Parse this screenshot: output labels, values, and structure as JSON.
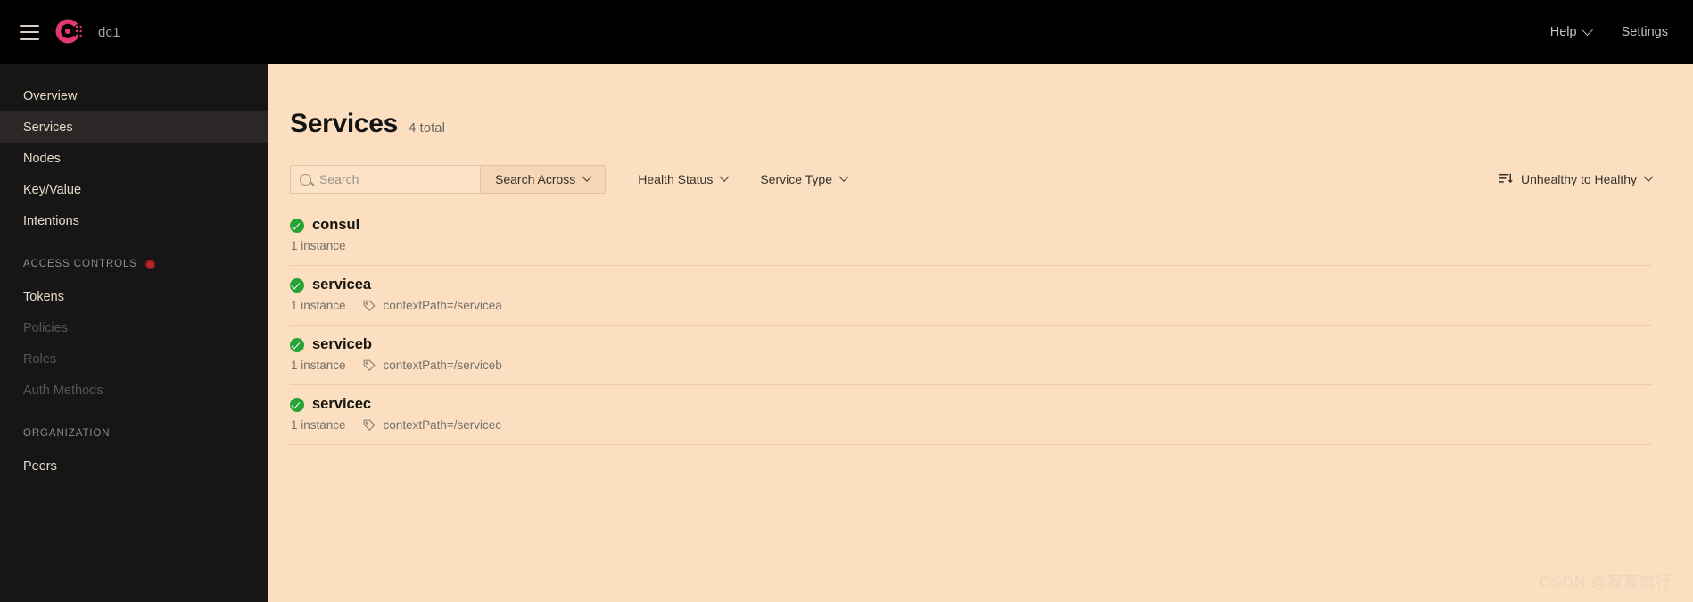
{
  "topbar": {
    "menu_icon": "hamburger-icon",
    "logo_icon": "consul-logo-icon",
    "datacenter": "dc1",
    "help_label": "Help",
    "settings_label": "Settings"
  },
  "sidebar": {
    "items": [
      {
        "label": "Overview",
        "active": false,
        "disabled": false
      },
      {
        "label": "Services",
        "active": true,
        "disabled": false
      },
      {
        "label": "Nodes",
        "active": false,
        "disabled": false
      },
      {
        "label": "Key/Value",
        "active": false,
        "disabled": false
      },
      {
        "label": "Intentions",
        "active": false,
        "disabled": false
      }
    ],
    "access_controls": {
      "title": "Access Controls",
      "badge_icon": "alert-dot-icon",
      "items": [
        {
          "label": "Tokens",
          "disabled": false
        },
        {
          "label": "Policies",
          "disabled": true
        },
        {
          "label": "Roles",
          "disabled": true
        },
        {
          "label": "Auth Methods",
          "disabled": true
        }
      ]
    },
    "organization": {
      "title": "Organization",
      "items": [
        {
          "label": "Peers",
          "disabled": false
        }
      ]
    }
  },
  "main": {
    "title": "Services",
    "total": "4 total",
    "toolbar": {
      "search_placeholder": "Search",
      "search_value": "",
      "search_icon": "search-icon",
      "search_across_label": "Search Across",
      "health_status_label": "Health Status",
      "service_type_label": "Service Type",
      "sort_label": "Unhealthy to Healthy",
      "sort_icon": "sort-descending-icon"
    },
    "services": [
      {
        "name": "consul",
        "health": "passing",
        "health_icon": "check-circle-icon",
        "instances": "1 instance",
        "tag": ""
      },
      {
        "name": "servicea",
        "health": "passing",
        "health_icon": "check-circle-icon",
        "instances": "1 instance",
        "tag": "contextPath=/servicea",
        "tag_icon": "tag-icon"
      },
      {
        "name": "serviceb",
        "health": "passing",
        "health_icon": "check-circle-icon",
        "instances": "1 instance",
        "tag": "contextPath=/serviceb",
        "tag_icon": "tag-icon"
      },
      {
        "name": "servicec",
        "health": "passing",
        "health_icon": "check-circle-icon",
        "instances": "1 instance",
        "tag": "contextPath=/servicec",
        "tag_icon": "tag-icon"
      }
    ]
  },
  "watermark": "CSDN @寂寞旅行",
  "colors": {
    "topbar_bg": "#000000",
    "sidebar_bg": "#161616",
    "sidebar_active_bg": "#2b2727",
    "main_bg": "#fbdfc0",
    "brand": "#e03875",
    "health_green": "#27a335",
    "alert_red": "#c0252e"
  }
}
